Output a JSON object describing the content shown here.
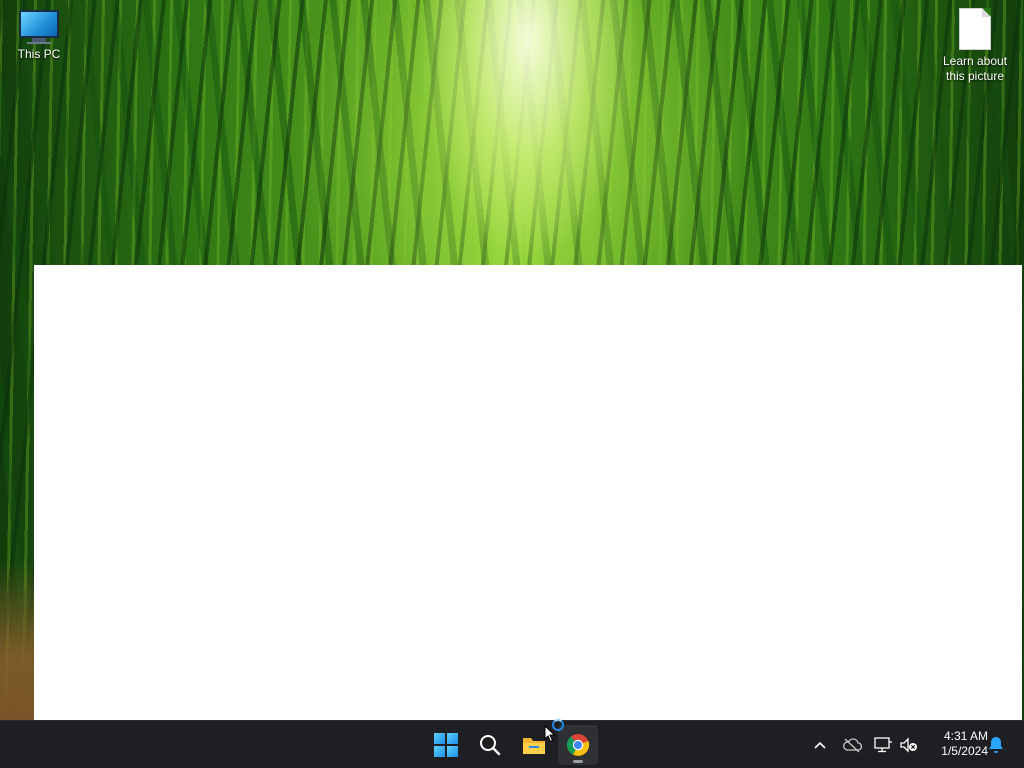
{
  "desktop": {
    "icons": [
      {
        "label": "This PC",
        "icon": "monitor-icon"
      },
      {
        "label": "Learn about this picture",
        "icon": "document-icon"
      }
    ]
  },
  "taskbar": {
    "apps": [
      {
        "name": "Start",
        "icon": "windows-logo-icon"
      },
      {
        "name": "Search",
        "icon": "search-icon"
      },
      {
        "name": "File Explorer",
        "icon": "folder-icon"
      },
      {
        "name": "Google Chrome",
        "icon": "chrome-icon",
        "running": true
      }
    ],
    "tray": {
      "icons": [
        "chevron-up-icon",
        "onedrive-offline-icon",
        "network-icon",
        "volume-muted-icon",
        "notification-bell-icon"
      ]
    },
    "clock": {
      "time": "4:31 AM",
      "date": "1/5/2024"
    }
  },
  "colors": {
    "taskbar_bg": "#1d1f22",
    "accent": "#1a8fe8",
    "notification": "#2aa5ff"
  }
}
